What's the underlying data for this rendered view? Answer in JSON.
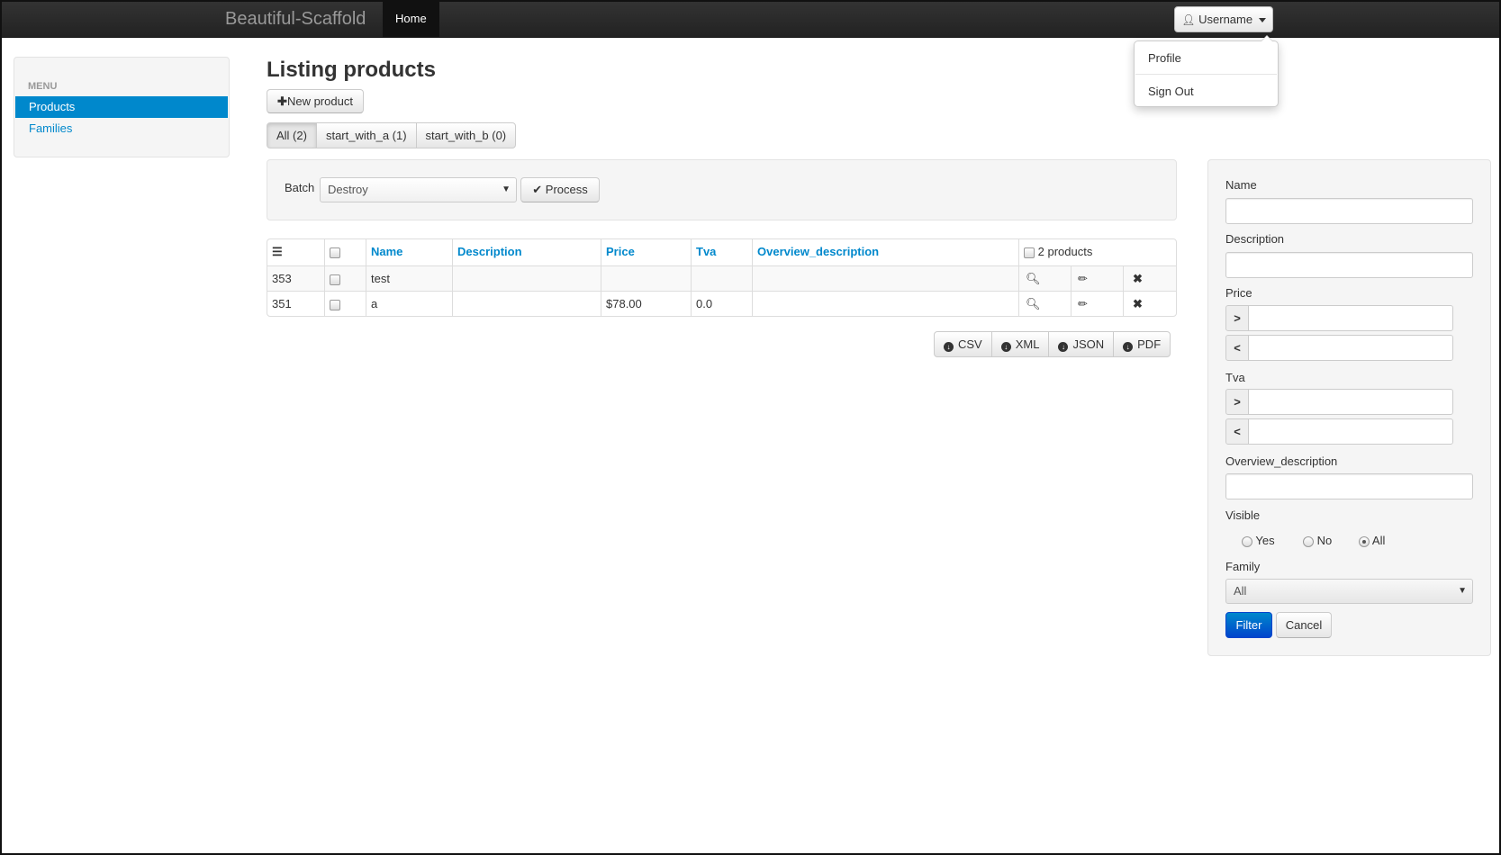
{
  "navbar": {
    "brand": "Beautiful-Scaffold",
    "home": "Home",
    "user": "Username"
  },
  "user_menu": {
    "items": [
      "Profile",
      "Sign Out"
    ]
  },
  "sidebar": {
    "header": "MENU",
    "items": [
      {
        "label": "Products",
        "active": true
      },
      {
        "label": "Families",
        "active": false
      }
    ]
  },
  "main": {
    "title": "Listing products",
    "new_button": "New product",
    "scopes": [
      "All (2)",
      "start_with_a (1)",
      "start_with_b (0)"
    ],
    "batch": {
      "label": "Batch",
      "selected": "Destroy",
      "process": "Process"
    },
    "table": {
      "columns": [
        "Name",
        "Description",
        "Price",
        "Tva",
        "Overview_description"
      ],
      "count_label": "2 products",
      "rows": [
        {
          "id": "353",
          "name": "test",
          "description": "",
          "price": "",
          "tva": "",
          "overview": ""
        },
        {
          "id": "351",
          "name": "a",
          "description": "",
          "price": "$78.00",
          "tva": "0.0",
          "overview": ""
        }
      ]
    },
    "exports": [
      "CSV",
      "XML",
      "JSON",
      "PDF"
    ]
  },
  "filter": {
    "name_label": "Name",
    "description_label": "Description",
    "price_label": "Price",
    "tva_label": "Tva",
    "overview_label": "Overview_description",
    "visible_label": "Visible",
    "visible_options": [
      "Yes",
      "No",
      "All"
    ],
    "visible_selected": "All",
    "family_label": "Family",
    "family_selected": "All",
    "filter_button": "Filter",
    "cancel_button": "Cancel"
  },
  "colors": {
    "accent": "#0088cc",
    "navbar": "#222222"
  }
}
